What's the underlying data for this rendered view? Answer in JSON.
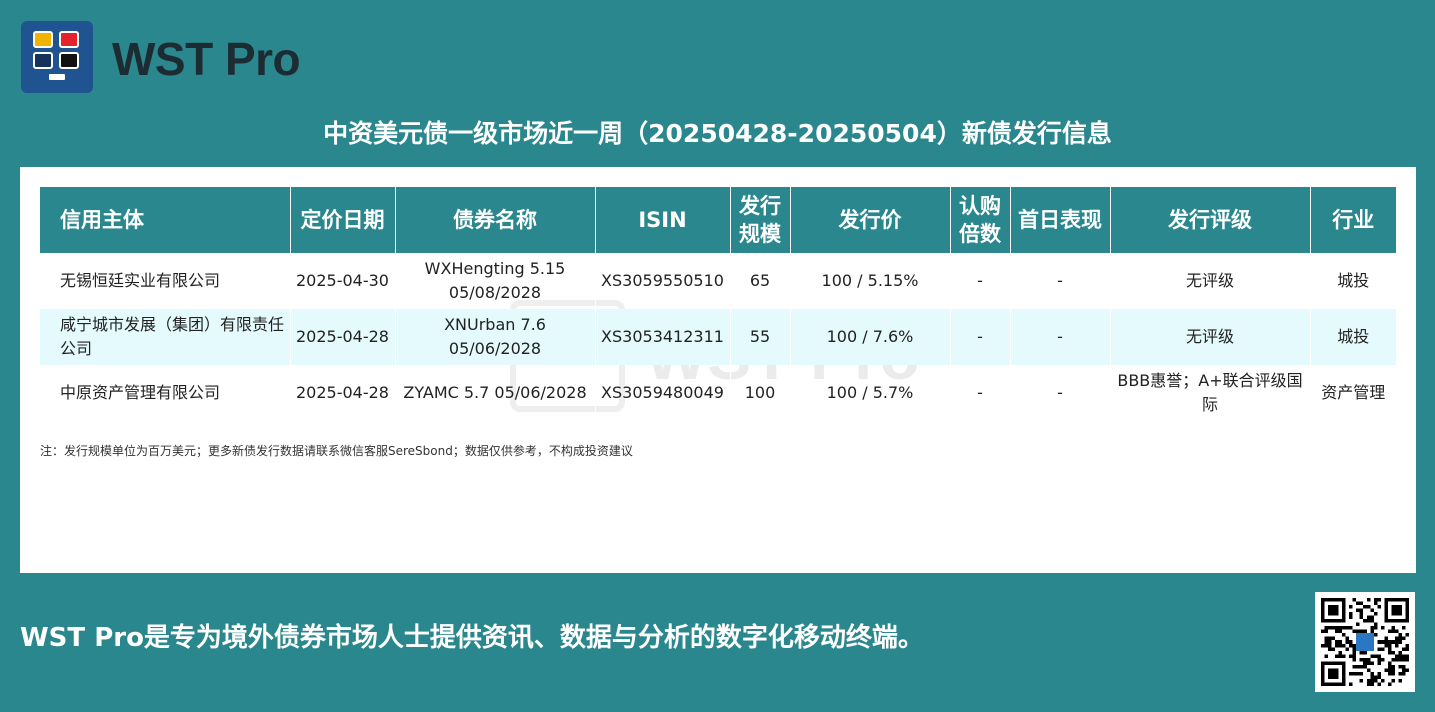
{
  "brand": {
    "name": "WST Pro"
  },
  "title": "中资美元债一级市场近一周（20250428-20250504）新债发行信息",
  "table": {
    "headers": [
      "信用主体",
      "定价日期",
      "债券名称",
      "ISIN",
      "发行规模",
      "发行价",
      "认购倍数",
      "首日表现",
      "发行评级",
      "行业"
    ],
    "rows": [
      {
        "issuer": "无锡恒廷实业有限公司",
        "pricing_date": "2025-04-30",
        "bond_name": "WXHengting 5.15 05/08/2028",
        "isin": "XS3059550510",
        "size": "65",
        "price": "100 / 5.15%",
        "subscription": "-",
        "first_day": "-",
        "rating": "无评级",
        "industry": "城投"
      },
      {
        "issuer": "咸宁城市发展（集团）有限责任公司",
        "pricing_date": "2025-04-28",
        "bond_name": "XNUrban 7.6 05/06/2028",
        "isin": "XS3053412311",
        "size": "55",
        "price": "100 / 7.6%",
        "subscription": "-",
        "first_day": "-",
        "rating": "无评级",
        "industry": "城投"
      },
      {
        "issuer": "中原资产管理有限公司",
        "pricing_date": "2025-04-28",
        "bond_name": "ZYAMC 5.7 05/06/2028",
        "isin": "XS3059480049",
        "size": "100",
        "price": "100 / 5.7%",
        "subscription": "-",
        "first_day": "-",
        "rating": "BBB惠誉；A+联合评级国际",
        "industry": "资产管理"
      }
    ]
  },
  "note": "注：发行规模单位为百万美元；更多新债发行数据请联系微信客服SereSbond；数据仅供参考，不构成投资建议",
  "footer": "WST Pro是专为境外债券市场人士提供资讯、数据与分析的数字化移动终端。",
  "colors": {
    "background": "#2a878d",
    "header": "#2a878d",
    "alt_row": "#e4fafd",
    "logo_bg": "#1f5490"
  },
  "icons": [
    "logo-icon",
    "qr-code-icon"
  ]
}
